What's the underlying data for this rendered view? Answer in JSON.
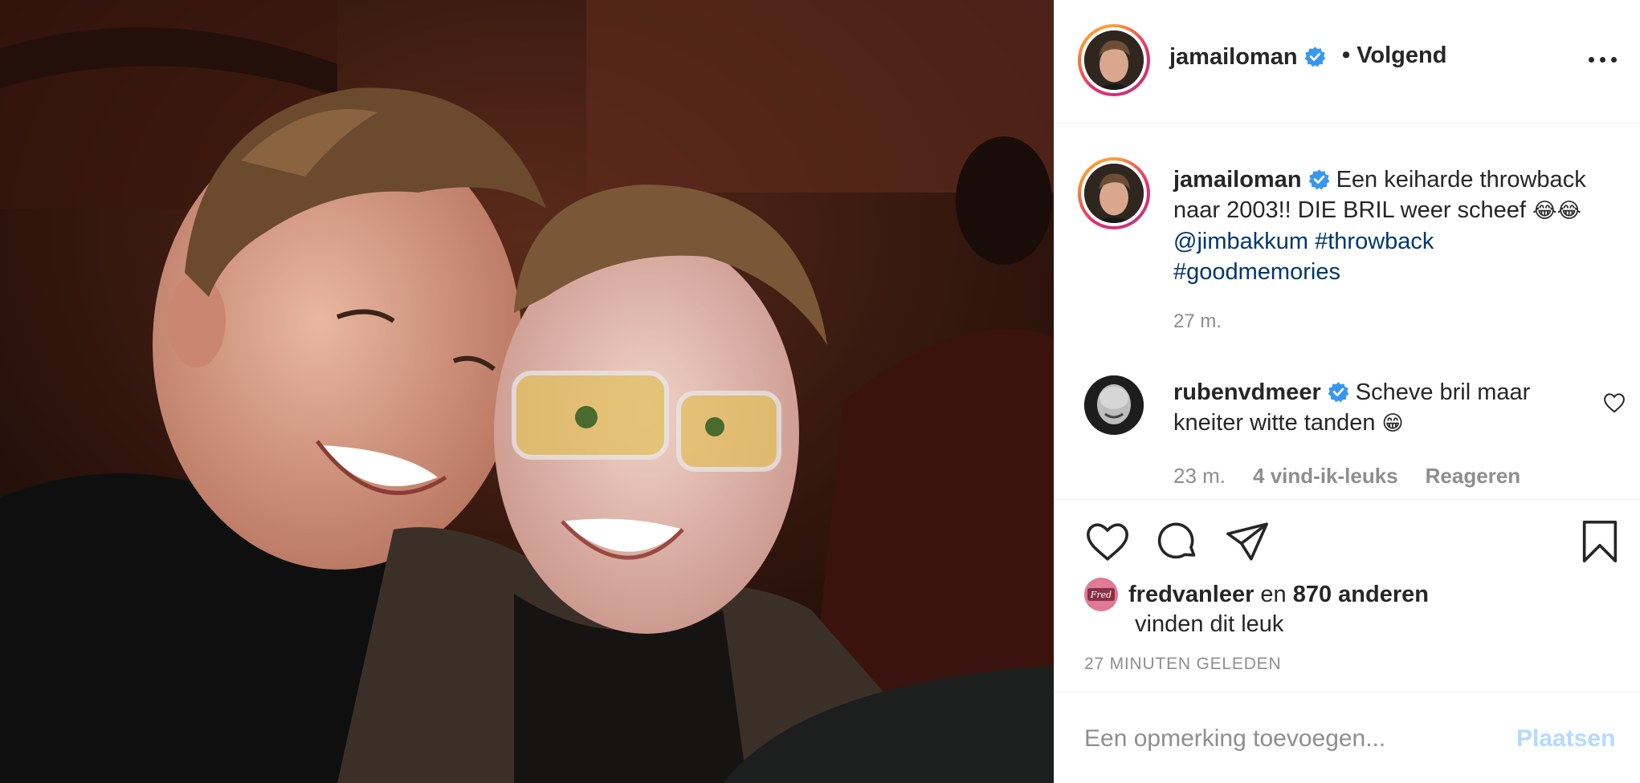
{
  "post": {
    "author": "jamailoman",
    "follow_status": "Volgend"
  },
  "caption": {
    "username": "jamailoman",
    "text": "Een keiharde throwback naar 2003!! DIE BRIL weer scheef ",
    "emoji": "😂😂",
    "mention": "@jimbakkum",
    "tags": [
      "#throwback",
      "#goodmemories"
    ],
    "time": "27 m."
  },
  "comment": {
    "username": "rubenvdmeer",
    "text": "Scheve bril maar kneiter witte tanden ",
    "emoji": "😁",
    "time": "23 m.",
    "likes": "4 vind-ik-leuks",
    "reply": "Reageren"
  },
  "likes": {
    "user": "fredvanleer",
    "connector": " en ",
    "others": "870 anderen",
    "suffix": "vinden dit leuk",
    "avatar_text": "Fred"
  },
  "timestamp": "27 MINUTEN GELEDEN",
  "add_comment": {
    "placeholder": "Een opmerking toevoegen...",
    "post_label": "Plaatsen"
  },
  "icons": {
    "verified": "verified-badge-icon",
    "more": "more-options-icon",
    "like": "heart-icon",
    "comment": "comment-bubble-icon",
    "share": "paper-plane-icon",
    "save": "bookmark-icon"
  },
  "colors": {
    "verified": "#3897f0",
    "link": "#00376b",
    "muted": "#8e8e8e",
    "post_disabled": "#b3dbff"
  }
}
